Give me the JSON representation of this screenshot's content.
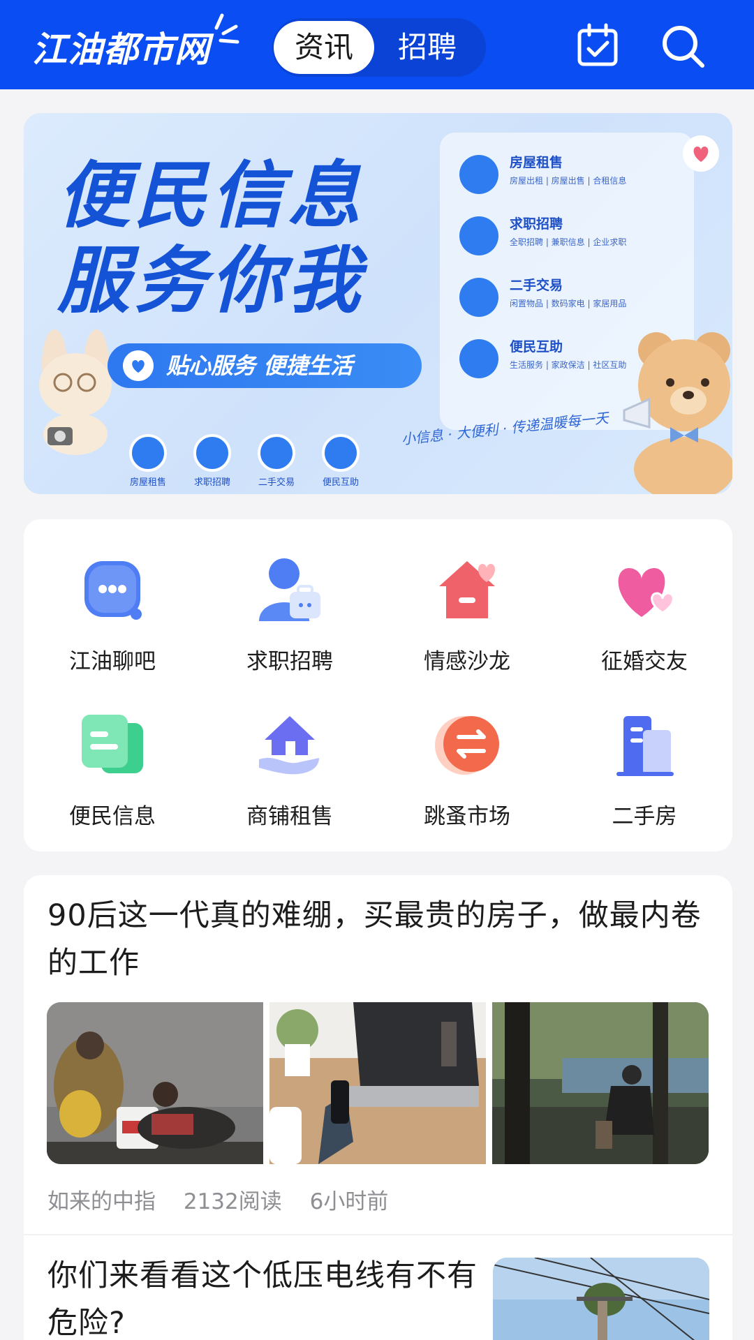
{
  "header": {
    "logo": "江油都市网",
    "tabs": [
      {
        "label": "资讯",
        "active": true
      },
      {
        "label": "招聘",
        "active": false
      }
    ],
    "icons": [
      "calendar-check-icon",
      "search-icon"
    ],
    "brand_color": "#0a4df2"
  },
  "banner": {
    "title_line1": "便民信息",
    "title_line2": "服务你我",
    "pill_text": "贴心服务 便捷生活",
    "slogan": "小信息 · 大便利 · 传递温暖每一天",
    "panel_rows": [
      {
        "title": "房屋租售",
        "sub": "房屋出租 | 房屋出售 | 合租信息",
        "icon": "house-icon"
      },
      {
        "title": "求职招聘",
        "sub": "全职招聘 | 兼职信息 | 企业求职",
        "icon": "briefcase-icon"
      },
      {
        "title": "二手交易",
        "sub": "闲置物品 | 数码家电 | 家居用品",
        "icon": "cart-icon"
      },
      {
        "title": "便民互助",
        "sub": "生活服务 | 家政保洁 | 社区互助",
        "icon": "help-icon"
      }
    ],
    "mini_items": [
      {
        "label": "房屋租售",
        "icon": "house-icon"
      },
      {
        "label": "求职招聘",
        "icon": "briefcase-icon"
      },
      {
        "label": "二手交易",
        "icon": "cart-icon"
      },
      {
        "label": "便民互助",
        "icon": "help-icon"
      }
    ]
  },
  "grid": [
    {
      "label": "江油聊吧",
      "icon": "chat-bubble-icon"
    },
    {
      "label": "求职招聘",
      "icon": "user-briefcase-icon"
    },
    {
      "label": "情感沙龙",
      "icon": "house-heart-icon"
    },
    {
      "label": "征婚交友",
      "icon": "hearts-icon"
    },
    {
      "label": "便民信息",
      "icon": "cards-icon"
    },
    {
      "label": "商铺租售",
      "icon": "hand-house-icon"
    },
    {
      "label": "跳蚤市场",
      "icon": "exchange-icon"
    },
    {
      "label": "二手房",
      "icon": "building-icon"
    }
  ],
  "news": [
    {
      "title": "90后这一代真的难绷，买最贵的房子，做最内卷的工作",
      "author": "如来的中指",
      "reads": "2132阅读",
      "time": "6小时前",
      "images": [
        "people-sleeping-photo",
        "laptop-phone-photo",
        "person-sitting-photo"
      ]
    },
    {
      "title": "你们来看看这个低压电线有不有危险?",
      "image": "power-pole-photo"
    }
  ]
}
